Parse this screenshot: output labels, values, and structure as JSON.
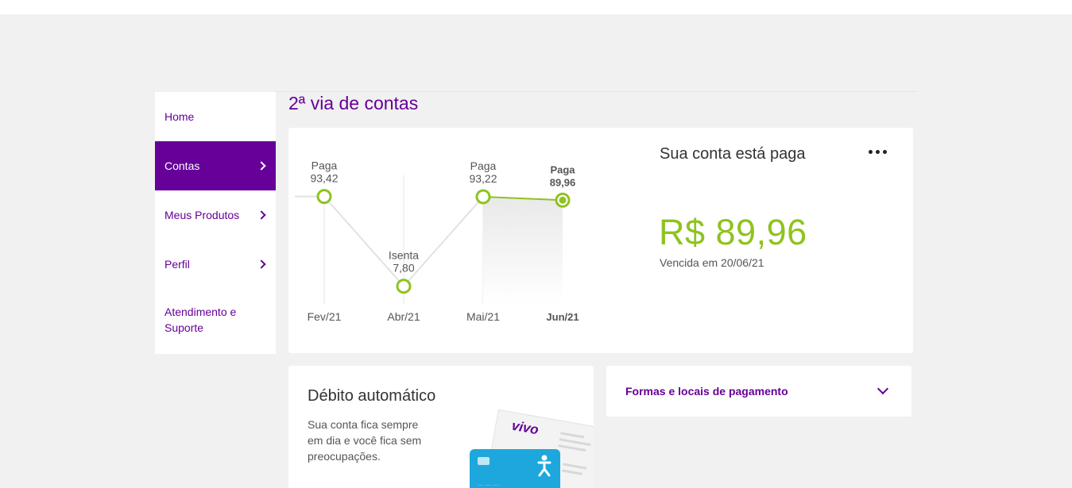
{
  "sidebar": {
    "items": [
      {
        "label": "Home",
        "active": false,
        "has_chevron": false
      },
      {
        "label": "Contas",
        "active": true,
        "has_chevron": true
      },
      {
        "label": "Meus Produtos",
        "active": false,
        "has_chevron": true
      },
      {
        "label": "Perfil",
        "active": false,
        "has_chevron": true
      },
      {
        "label": "Atendimento e Suporte",
        "active": false,
        "has_chevron": false
      }
    ]
  },
  "page": {
    "title": "2ª via de contas"
  },
  "bill": {
    "status_title": "Sua conta está paga",
    "amount": "R$ 89,96",
    "due_text": "Vencida em 20/06/21",
    "menu_icon": "more-horizontal-icon"
  },
  "chart_data": {
    "type": "line",
    "categories": [
      "Fev/21",
      "Abr/21",
      "Mai/21",
      "Jun/21"
    ],
    "values": [
      93.42,
      7.8,
      93.22,
      89.96
    ],
    "point_status": [
      "Paga",
      "Isenta",
      "Paga",
      "Paga"
    ],
    "point_value_labels": [
      "93,42",
      "7,80",
      "93,22",
      "89,96"
    ],
    "selected_index": 3,
    "title": "",
    "xlabel": "",
    "ylabel": ""
  },
  "debit": {
    "title": "Débito automático",
    "description": "Sua conta fica sempre em dia e você fica sem preocupações.",
    "brand": "vivo"
  },
  "payment": {
    "title": "Formas e locais de pagamento",
    "chevron_icon": "chevron-down-icon"
  },
  "colors": {
    "brand_purple": "#660099",
    "accent_green": "#8fc31f",
    "background": "#f1f1f1",
    "card_blue": "#1ea7dc"
  }
}
